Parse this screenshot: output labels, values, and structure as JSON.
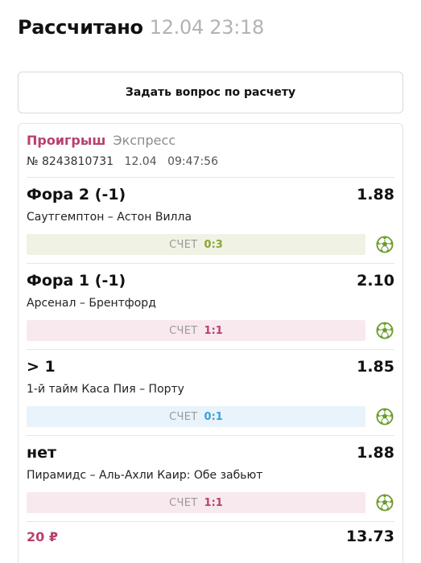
{
  "header": {
    "title": "Рассчитано",
    "timestamp": "12.04 23:18"
  },
  "ask_button": {
    "label": "Задать вопрос по расчету"
  },
  "coupon": {
    "status": "Проигрыш",
    "bet_type": "Экспресс",
    "number": "№ 8243810731",
    "date": "12.04",
    "time": "09:47:56",
    "score_label": "СЧЕТ",
    "stake": "20 ₽",
    "payout": "13.73",
    "colors": {
      "lost_accent": "#b8406f",
      "green_accent": "#8aa534",
      "blue_accent": "#3aa0d8",
      "ball_green": "#6a9a2a"
    },
    "bets": [
      {
        "outcome": "Фора 2 (-1)",
        "odd": "1.88",
        "event": "Саутгемптон – Астон Вилла",
        "score": "0:3",
        "result": "won",
        "icon": "football-ball-icon"
      },
      {
        "outcome": "Фора 1 (-1)",
        "odd": "2.10",
        "event": "Арсенал – Брентфорд",
        "score": "1:1",
        "result": "lost",
        "icon": "football-ball-icon"
      },
      {
        "outcome": "> 1",
        "odd": "1.85",
        "event": "1-й тайм Каса Пия – Порту",
        "score": "0:1",
        "result": "returned",
        "icon": "football-ball-icon"
      },
      {
        "outcome": "нет",
        "odd": "1.88",
        "event": "Пирамидс – Аль-Ахли Каир: Обе забьют",
        "score": "1:1",
        "result": "lost",
        "icon": "football-ball-icon"
      }
    ]
  }
}
